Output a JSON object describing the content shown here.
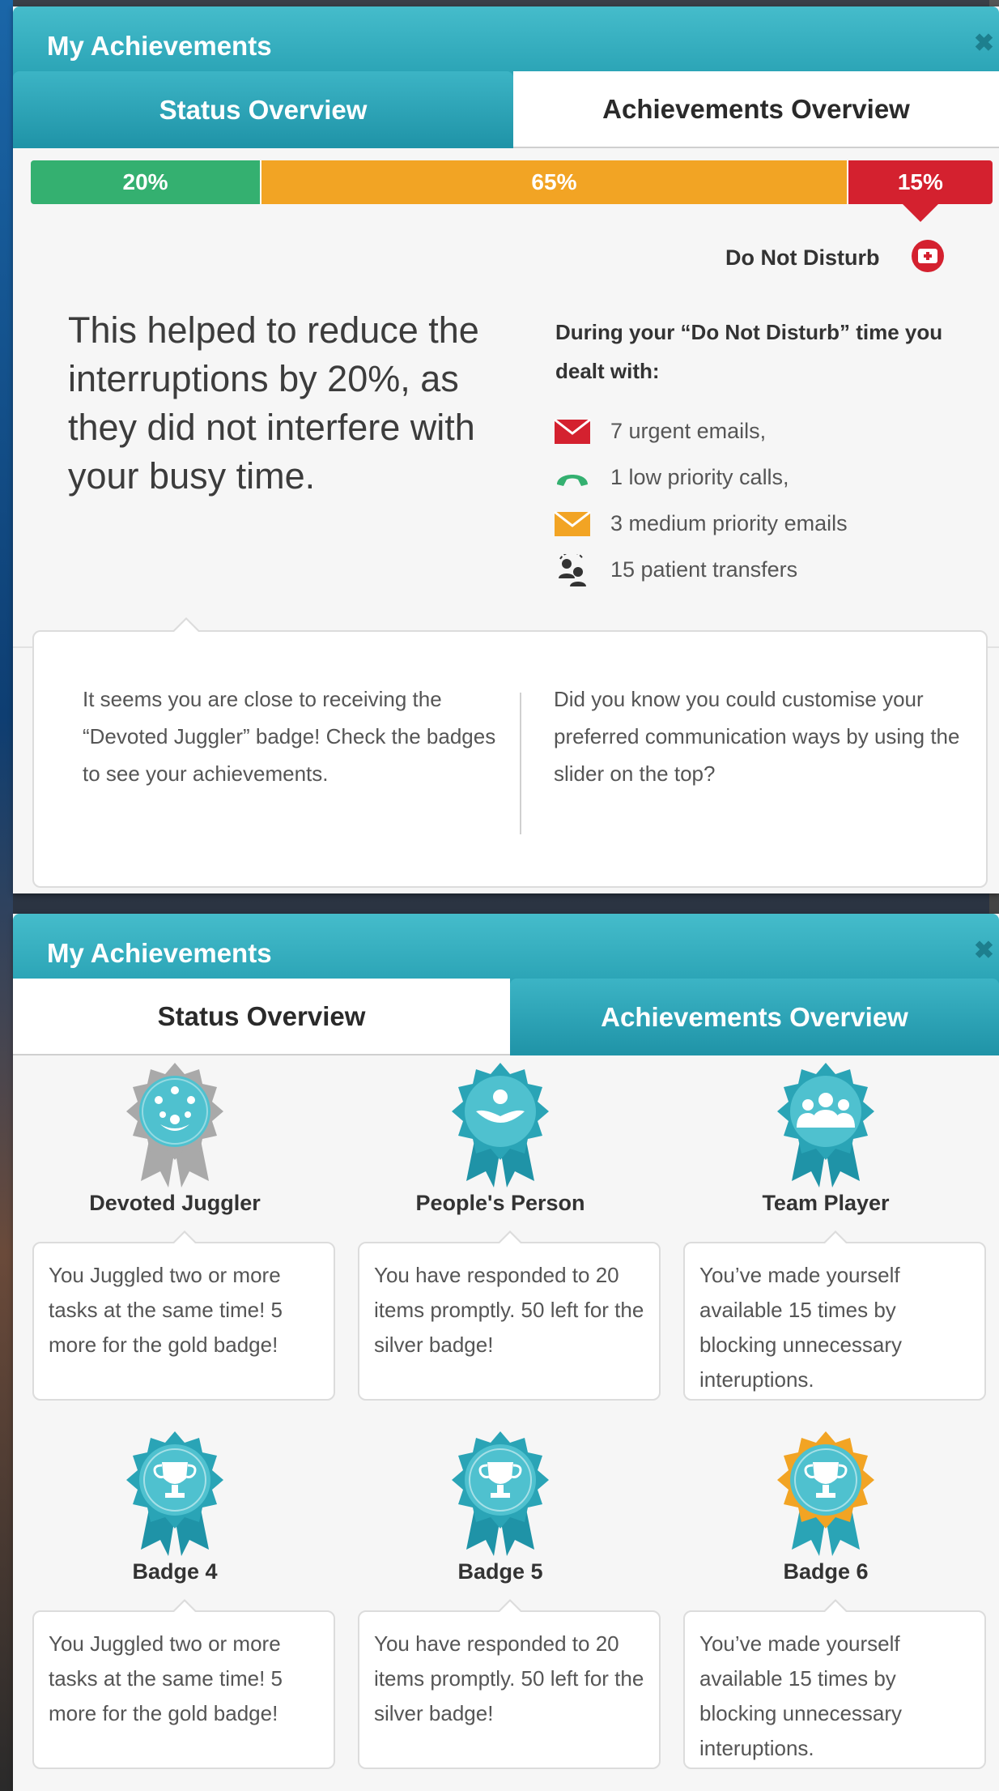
{
  "panel1": {
    "title": "My Achievements",
    "close_icon": "close-icon",
    "tabs": [
      {
        "label": "Status Overview",
        "active": true
      },
      {
        "label": "Achievements Overview",
        "active": false
      }
    ],
    "progress": [
      {
        "label": "20%",
        "value": 20,
        "color": "#34b070"
      },
      {
        "label": "65%",
        "value": 65,
        "color": "#f2a424"
      },
      {
        "label": "15%",
        "value": 15,
        "color": "#d4212f"
      }
    ],
    "status_label": "Do Not Disturb",
    "status_icon": "do-not-disturb-icon",
    "summary": "This helped to reduce the interruptions by 20%, as they did not interfere with your busy time.",
    "dealt_title": "During your “Do Not Disturb” time you dealt with:",
    "dealt_items": [
      {
        "icon": "urgent-email-icon",
        "text": "7 urgent emails,",
        "color": "#d4212f"
      },
      {
        "icon": "phone-icon",
        "text": "1 low priority calls,",
        "color": "#34b070"
      },
      {
        "icon": "medium-email-icon",
        "text": "3 medium priority emails",
        "color": "#f2a424"
      },
      {
        "icon": "patient-transfer-icon",
        "text": "15 patient transfers",
        "color": "#333333"
      }
    ],
    "tip_left": "It seems you are close to receiving the “Devoted Juggler” badge! Check the badges to see your achievements.",
    "tip_right": "Did you know you could customise your preferred communication ways by using the slider on the top?"
  },
  "panel2": {
    "title": "My Achievements",
    "close_icon": "close-icon",
    "tabs": [
      {
        "label": "Status Overview",
        "active": false
      },
      {
        "label": "Achievements Overview",
        "active": true
      }
    ],
    "badges": [
      {
        "name": "Devoted Juggler",
        "icon": "juggler-badge-icon",
        "tier": "silver",
        "description": "You Juggled two or more tasks at the same time! 5 more for the gold badge!"
      },
      {
        "name": "People's Person",
        "icon": "people-person-badge-icon",
        "tier": "teal",
        "description": "You have responded to 20 items promptly. 50 left for the silver badge!"
      },
      {
        "name": "Team Player",
        "icon": "team-player-badge-icon",
        "tier": "teal",
        "description": "You’ve made yourself available 15 times by blocking unnecessary interuptions."
      },
      {
        "name": "Badge 4",
        "icon": "trophy-badge-icon",
        "tier": "teal",
        "description": "You Juggled two or more tasks at the same time! 5 more for the gold badge!"
      },
      {
        "name": "Badge 5",
        "icon": "trophy-badge-icon",
        "tier": "teal",
        "description": "You have responded to 20 items promptly. 50 left for the silver badge!"
      },
      {
        "name": "Badge 6",
        "icon": "trophy-badge-icon",
        "tier": "gold",
        "description": "You’ve made yourself available 15 times by blocking unnecessary interuptions."
      }
    ]
  },
  "colors": {
    "teal": "#2aa4b6",
    "teal_dark": "#1f93a7",
    "silver": "#a9a9a9",
    "gold": "#f2a424"
  }
}
